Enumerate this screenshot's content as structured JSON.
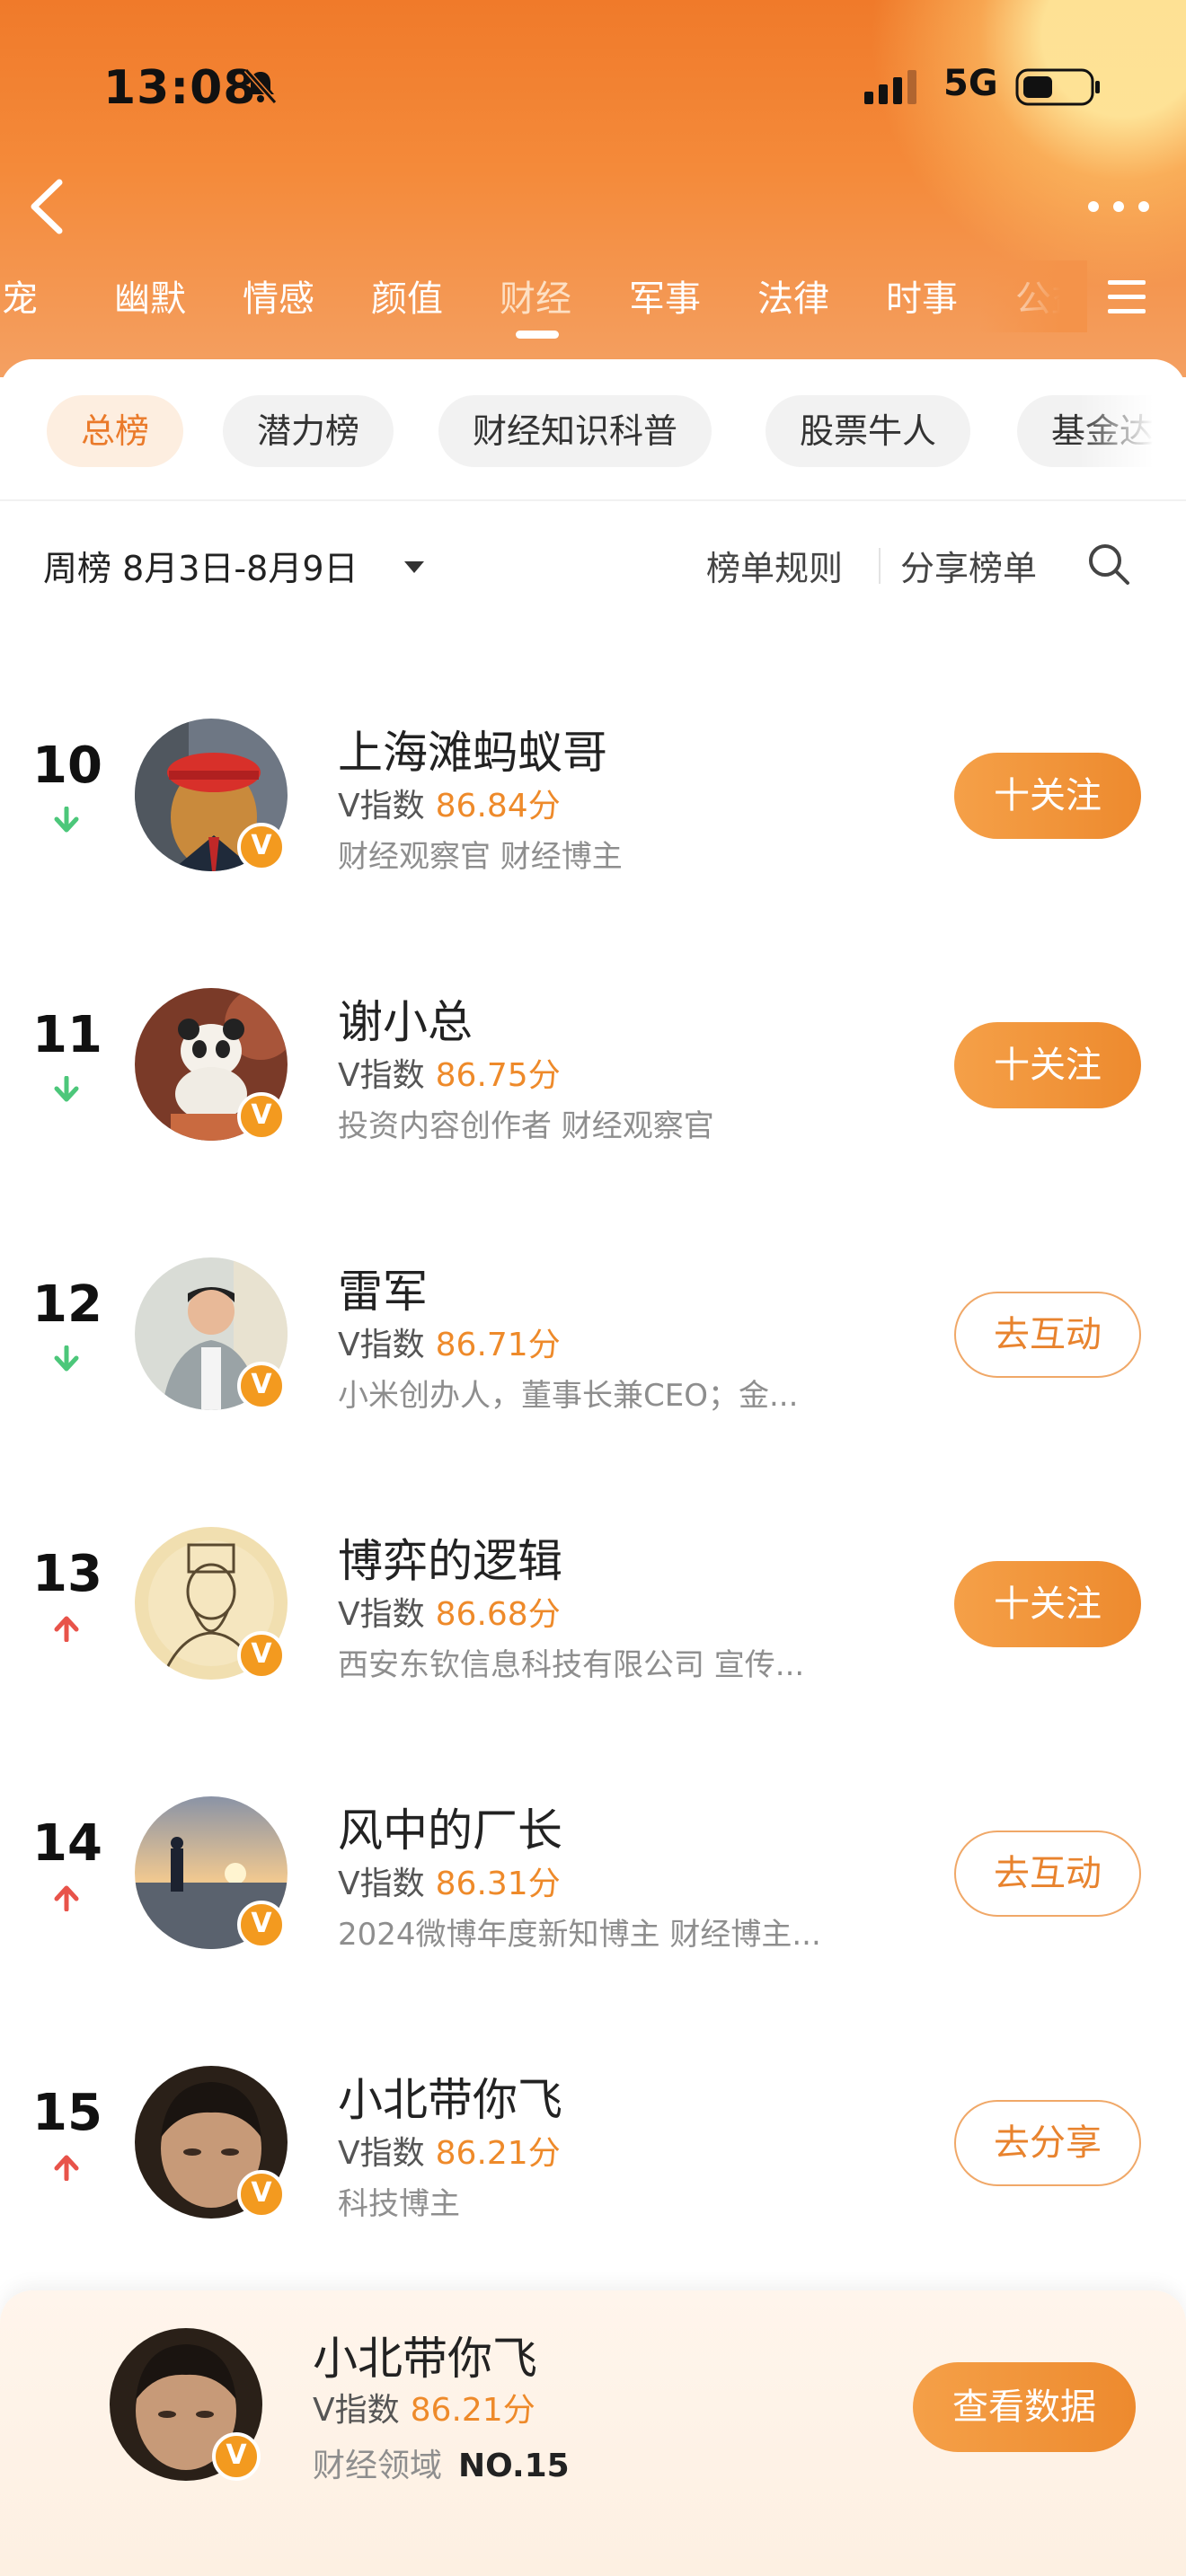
{
  "status_bar": {
    "time": "13:08",
    "network": "5G"
  },
  "top_tabs": [
    {
      "label": "萌宠",
      "active": false
    },
    {
      "label": "幽默",
      "active": false
    },
    {
      "label": "情感",
      "active": false
    },
    {
      "label": "颜值",
      "active": false
    },
    {
      "label": "财经",
      "active": true
    },
    {
      "label": "军事",
      "active": false
    },
    {
      "label": "法律",
      "active": false
    },
    {
      "label": "时事",
      "active": false
    },
    {
      "label": "公益",
      "active": false
    }
  ],
  "sub_tabs": [
    {
      "label": "总榜",
      "active": true
    },
    {
      "label": "潜力榜",
      "active": false
    },
    {
      "label": "财经知识科普",
      "active": false
    },
    {
      "label": "股票牛人",
      "active": false
    },
    {
      "label": "基金达人",
      "active": false
    }
  ],
  "filter": {
    "period": "周榜 8月3日-8月9日",
    "rules": "榜单规则",
    "share": "分享榜单"
  },
  "v_label": "V指数",
  "verified_badge": "V",
  "ranking": [
    {
      "rank": "10",
      "trend": "down",
      "name": "上海滩蚂蚁哥",
      "score": "86.84分",
      "tags": "财经观察官 财经博主",
      "action": "十关注",
      "action_style": "follow"
    },
    {
      "rank": "11",
      "trend": "down",
      "name": "谢小总",
      "score": "86.75分",
      "tags": "投资内容创作者 财经观察官",
      "action": "十关注",
      "action_style": "follow"
    },
    {
      "rank": "12",
      "trend": "down",
      "name": "雷军",
      "score": "86.71分",
      "tags": "小米创办人，董事长兼CEO；金...",
      "action": "去互动",
      "action_style": "outline"
    },
    {
      "rank": "13",
      "trend": "up",
      "name": "博弈的逻辑",
      "score": "86.68分",
      "tags": "西安东钦信息科技有限公司 宣传...",
      "action": "十关注",
      "action_style": "follow"
    },
    {
      "rank": "14",
      "trend": "up",
      "name": "风中的厂长",
      "score": "86.31分",
      "tags": "2024微博年度新知博主 财经博主...",
      "action": "去互动",
      "action_style": "outline"
    },
    {
      "rank": "15",
      "trend": "up",
      "name": "小北带你飞",
      "score": "86.21分",
      "tags": "科技博主",
      "action": "去分享",
      "action_style": "outline"
    }
  ],
  "my_card": {
    "name": "小北带你飞",
    "score": "86.21分",
    "domain": "财经领域",
    "rank": "NO.15",
    "button": "查看数据"
  },
  "colors": {
    "accent": "#ED8A2E",
    "up": "#E8534A",
    "down": "#4CC77A"
  }
}
